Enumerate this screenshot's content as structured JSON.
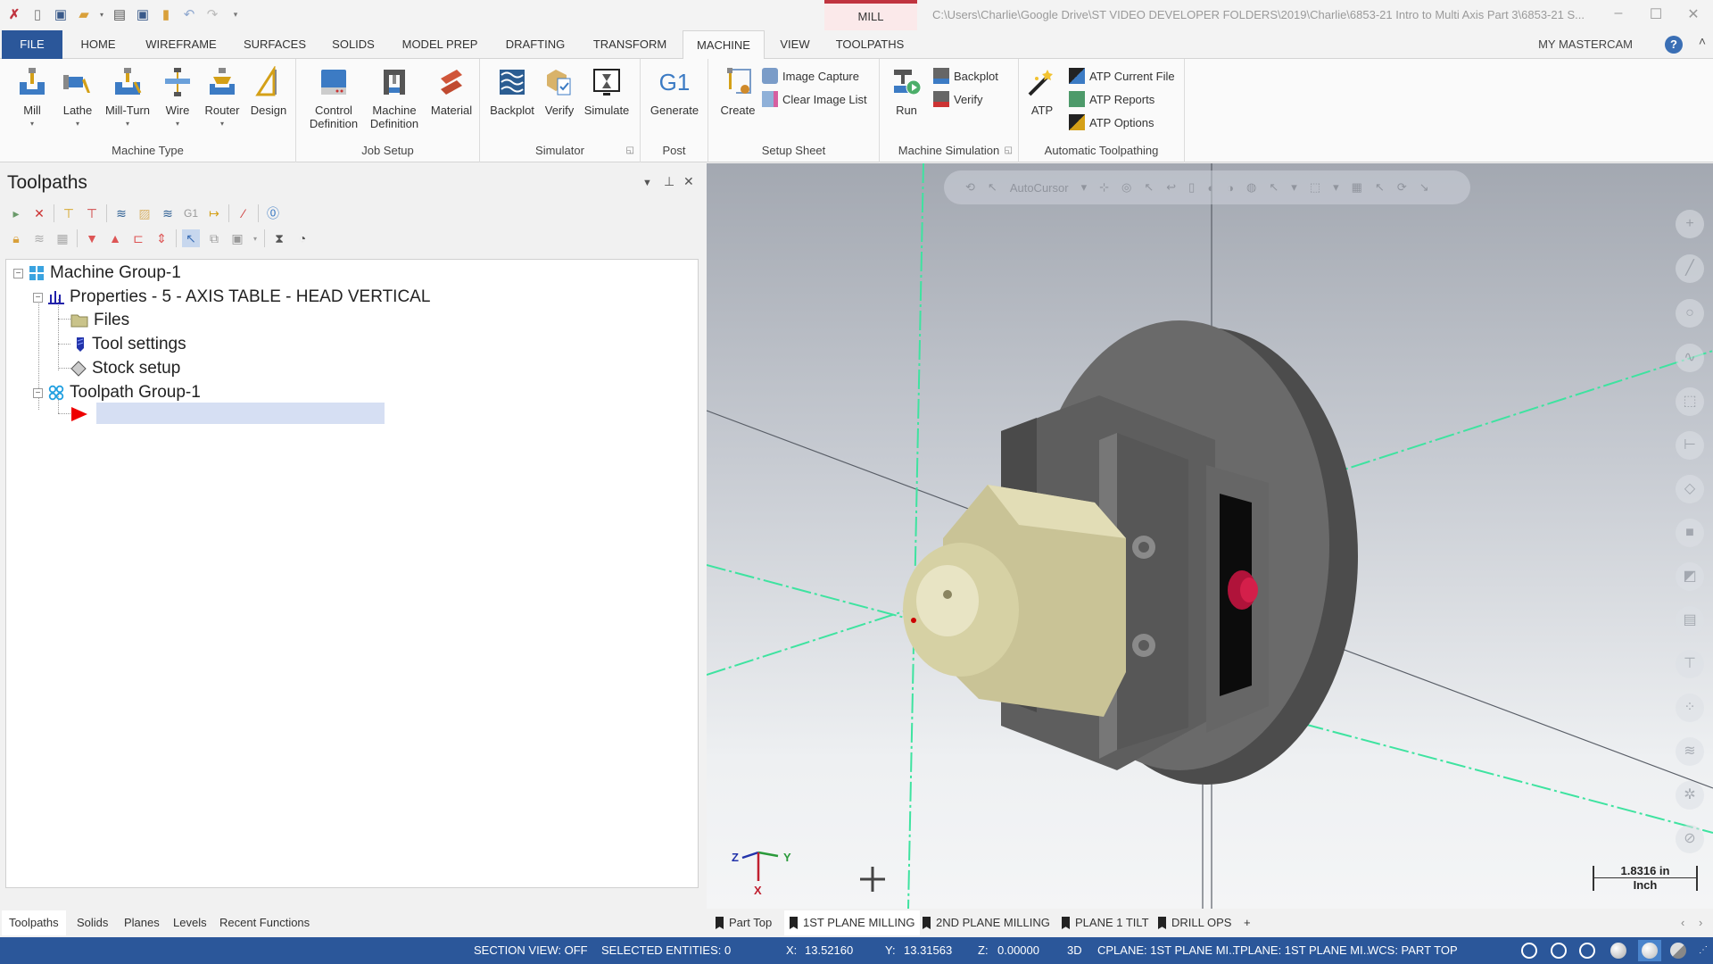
{
  "titlebar": {
    "context_tab": "MILL",
    "file_path": "C:\\Users\\Charlie\\Google Drive\\ST VIDEO DEVELOPER FOLDERS\\2019\\Charlie\\6853-21 Intro to Multi Axis Part 3\\6853-21 S...",
    "quick_access": [
      "app-logo-icon",
      "new-file-icon",
      "save-icon",
      "open-icon",
      "print-icon",
      "save-as-icon",
      "open-recent-icon",
      "undo-icon",
      "redo-icon",
      "customize-icon"
    ],
    "window_controls": {
      "minimize": "–",
      "maximize": "☐",
      "close": "✕"
    }
  },
  "tabs": {
    "items": [
      "FILE",
      "HOME",
      "WIREFRAME",
      "SURFACES",
      "SOLIDS",
      "MODEL PREP",
      "DRAFTING",
      "TRANSFORM",
      "MACHINE",
      "VIEW",
      "TOOLPATHS"
    ],
    "active": "MACHINE",
    "my_mastercam": "MY MASTERCAM",
    "help": "?"
  },
  "ribbon": {
    "machine_type": {
      "label": "Machine Type",
      "buttons": [
        "Mill",
        "Lathe",
        "Mill-Turn",
        "Wire",
        "Router",
        "Design"
      ]
    },
    "job_setup": {
      "label": "Job Setup",
      "control_definition": [
        "Control",
        "Definition"
      ],
      "machine_definition": [
        "Machine",
        "Definition"
      ],
      "material": "Material"
    },
    "simulator": {
      "label": "Simulator",
      "buttons": [
        "Backplot",
        "Verify",
        "Simulate"
      ]
    },
    "post": {
      "label": "Post",
      "icon_text": "G1",
      "button": "Generate"
    },
    "setup_sheet": {
      "label": "Setup Sheet",
      "create": "Create",
      "image_capture": "Image Capture",
      "clear_image_list": "Clear Image List"
    },
    "machine_simulation": {
      "label": "Machine Simulation",
      "run": "Run",
      "backplot": "Backplot",
      "verify": "Verify"
    },
    "automatic_toolpathing": {
      "label": "Automatic Toolpathing",
      "atp": "ATP",
      "atp_current_file": "ATP Current File",
      "atp_reports": "ATP Reports",
      "atp_options": "ATP Options"
    }
  },
  "toolpaths_panel": {
    "title": "Toolpaths",
    "tree": {
      "machine_group": "Machine Group-1",
      "properties": "Properties - 5 - AXIS TABLE - HEAD VERTICAL",
      "files": "Files",
      "tool_settings": "Tool settings",
      "stock_setup": "Stock setup",
      "toolpath_group": "Toolpath Group-1",
      "new_item_value": ""
    },
    "bottom_tabs": [
      "Toolpaths",
      "Solids",
      "Planes",
      "Levels",
      "Recent Functions"
    ],
    "active_bottom_tab": "Toolpaths"
  },
  "viewport": {
    "autocursor_label": "AutoCursor",
    "gnomon": {
      "x": "X",
      "y": "Y",
      "z": "Z"
    },
    "scale": {
      "value": "1.8316 in",
      "unit": "Inch"
    },
    "side_toolbar": [
      "add-icon",
      "line-icon",
      "circle-icon",
      "spline-icon",
      "solid-box-icon",
      "dimension-icon",
      "surface-icon",
      "solid-icon",
      "planes-icon",
      "levels-icon",
      "measure-icon",
      "points-icon",
      "layers-icon",
      "settings-icon",
      "cancel-icon"
    ],
    "view_tabs": [
      "Part Top",
      "1ST PLANE MILLING",
      "2ND PLANE MILLING",
      "PLANE 1 TILT",
      "DRILL OPS"
    ],
    "active_view_tab": "1ST PLANE MILLING",
    "add_tab": "+"
  },
  "statusbar": {
    "section_view": "SECTION VIEW: OFF",
    "selected_entities": "SELECTED ENTITIES: 0",
    "x_label": "X:",
    "x_value": "13.52160",
    "y_label": "Y:",
    "y_value": "13.31563",
    "z_label": "Z:",
    "z_value": "0.00000",
    "mode": "3D",
    "cplane": "CPLANE: 1ST PLANE MI...",
    "tplane": "TPLANE: 1ST PLANE MI...",
    "wcs": "WCS: PART TOP"
  },
  "colors": {
    "accent": "#2b579a",
    "context_red": "#c0343f",
    "axis_green": "#3ee3a0",
    "part_beige": "#d8d3a8",
    "fixture_gray": "#6a6a6a",
    "pin_red": "#c0183a"
  }
}
